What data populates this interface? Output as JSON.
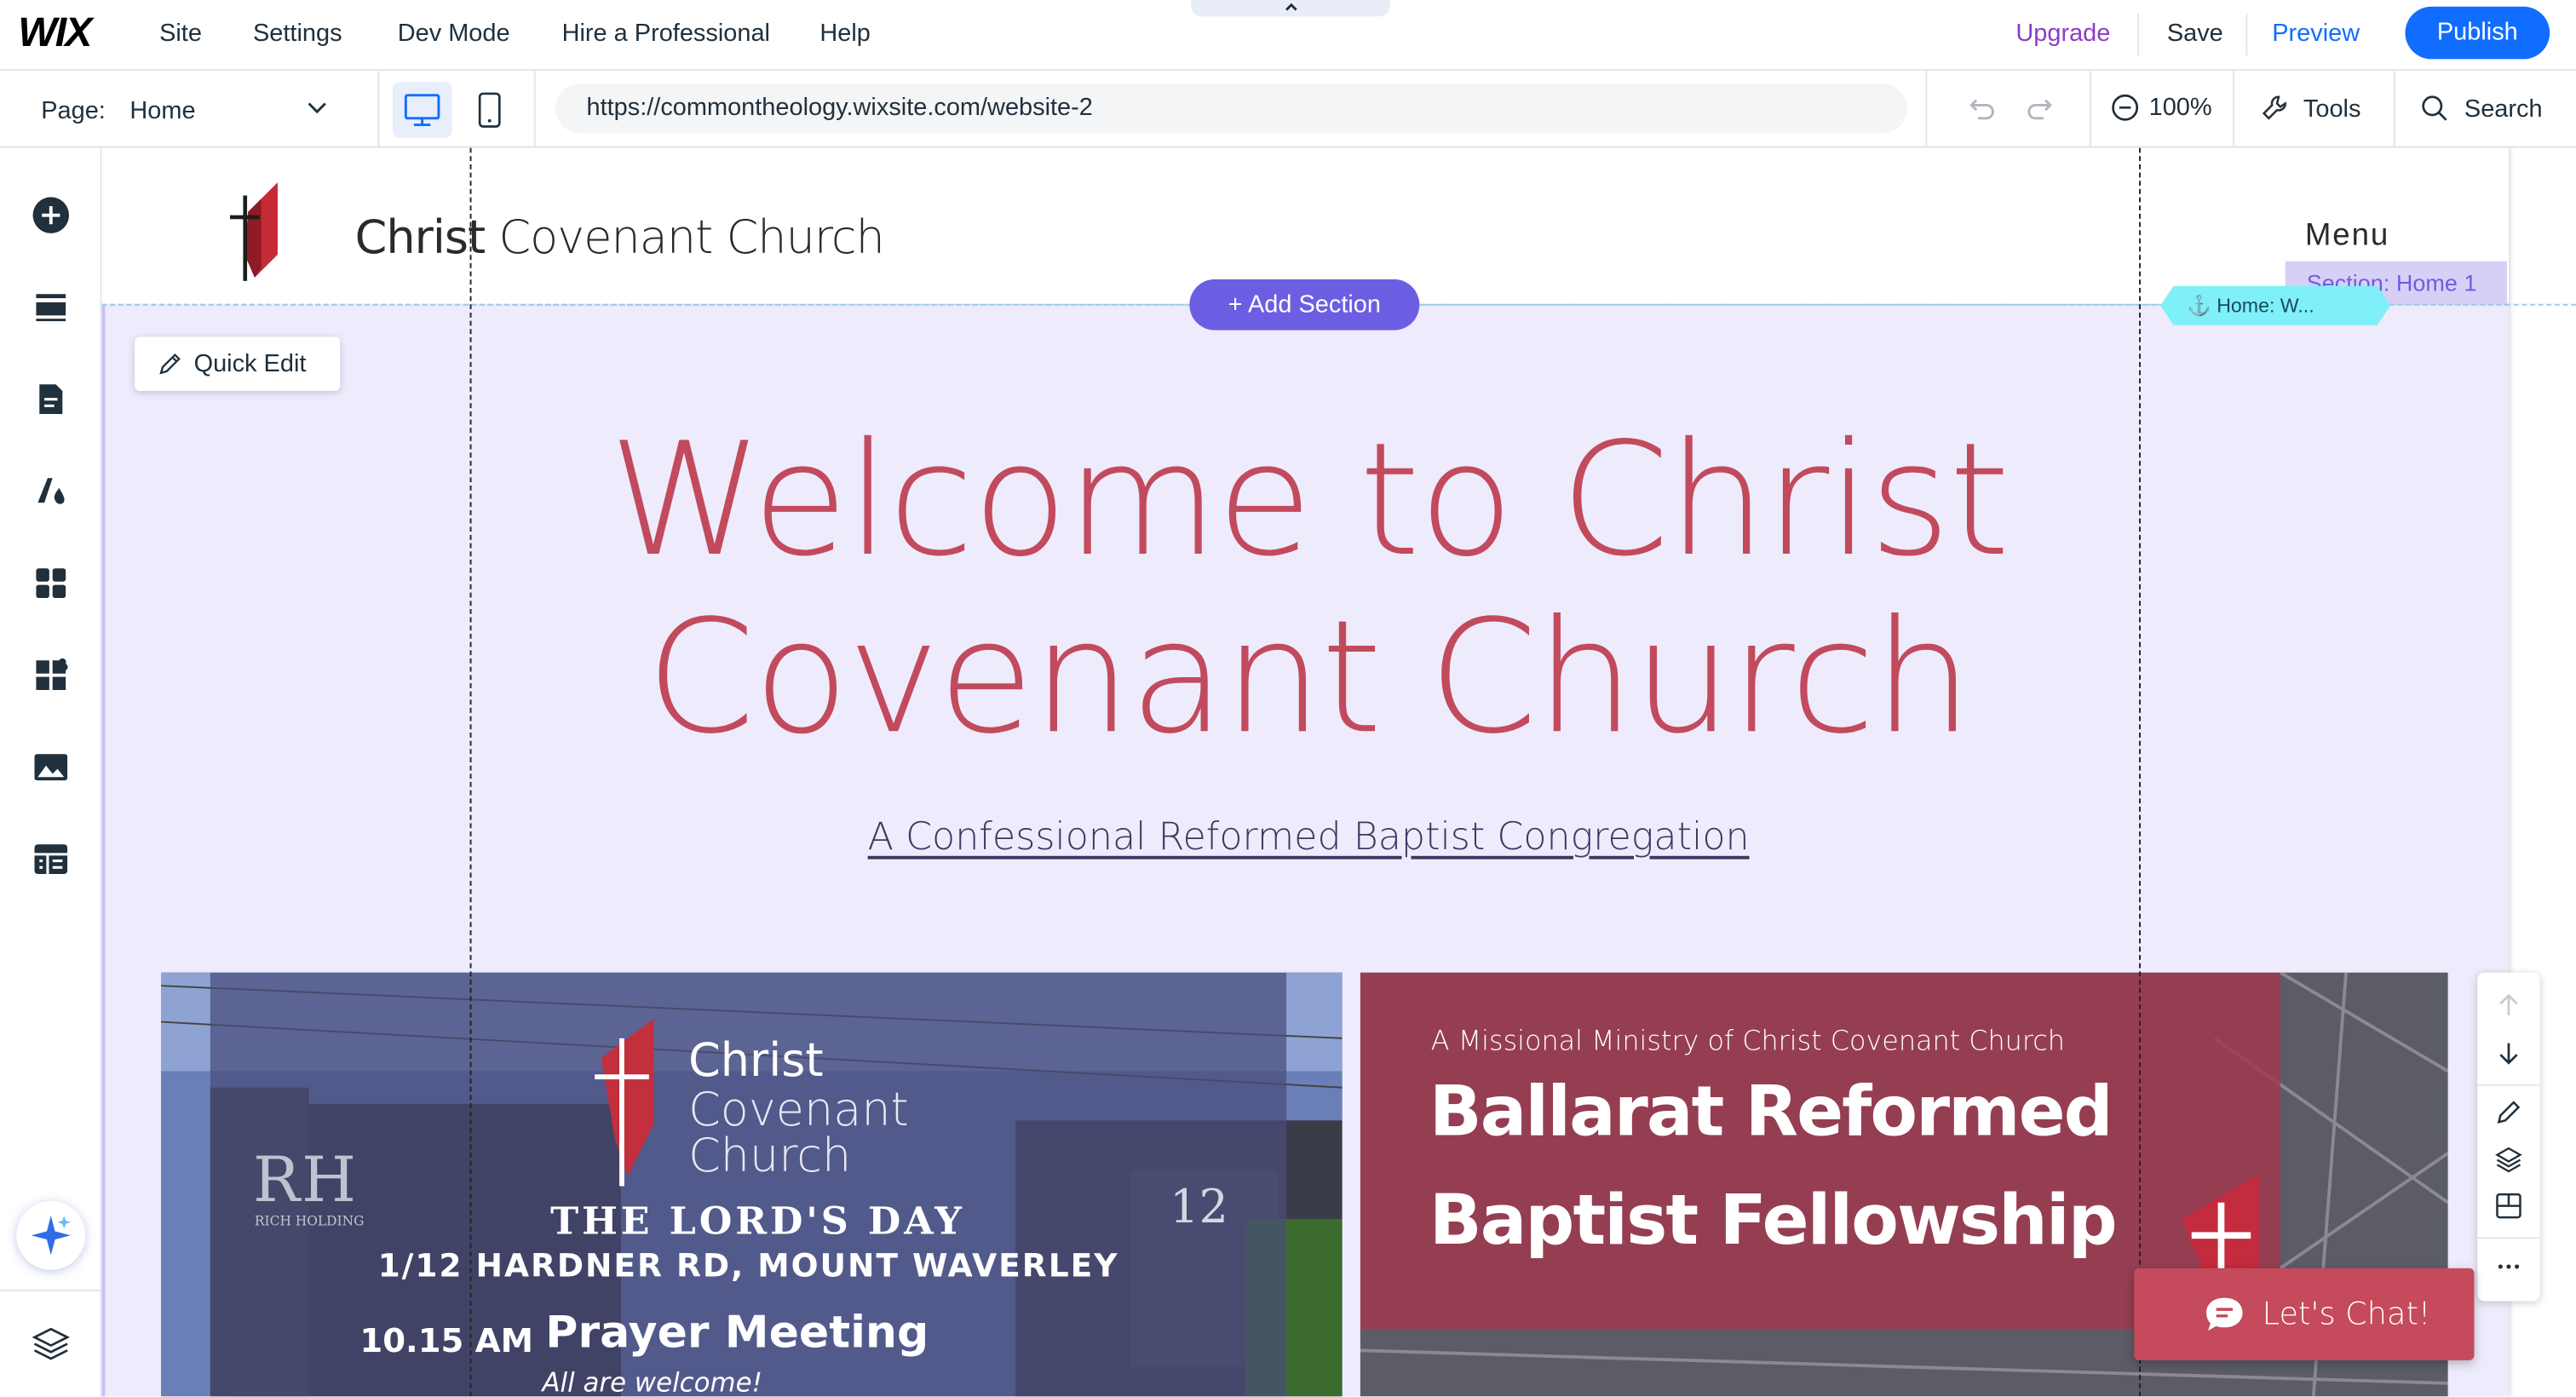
{
  "topbar": {
    "logo": "WIX",
    "menu": [
      "Site",
      "Settings",
      "Dev Mode",
      "Hire a Professional",
      "Help"
    ],
    "upgrade": "Upgrade",
    "save": "Save",
    "preview": "Preview",
    "publish": "Publish"
  },
  "subbar": {
    "page_label": "Page:",
    "page_name": "Home",
    "url": "https://commontheology.wixsite.com/website-2",
    "zoom": "100%",
    "tools": "Tools",
    "search": "Search"
  },
  "canvas": {
    "site_title_first": "Christ",
    "site_title_rest": " Covenant Church",
    "menu_label": "Menu",
    "section_tag": "Section: Home 1",
    "add_section": "+ Add Section",
    "anchor_tag": "⚓ Home: W...",
    "quick_edit": "Quick Edit",
    "hero_title": "Welcome to Christ Covenant Church",
    "hero_subtitle": "A Confessional Reformed Baptist Congregation",
    "lets_chat": "Let's Chat!"
  },
  "card_left": {
    "logo_line1": "Christ",
    "logo_line2": "Covenant",
    "logo_line3": "Church",
    "day": "THE LORD'S DAY",
    "address": "1/12 HARDNER RD, MOUNT WAVERLEY",
    "time": "10.15 AM",
    "event": "Prayer Meeting",
    "welcome": "All are welcome!",
    "sign_letters": "RH",
    "sign_text": "RICH HOLDING",
    "number": "12"
  },
  "card_right": {
    "kicker": "A Missional Ministry of Christ Covenant Church",
    "title_line1": "Ballarat Reformed",
    "title_line2": "Baptist Fellowship"
  },
  "colors": {
    "accent": "#116dff",
    "brand_red": "#c24a5d",
    "hero_bg": "#eeebfc",
    "add_section": "#6c5ee3",
    "upgrade": "#8a3ec6"
  }
}
